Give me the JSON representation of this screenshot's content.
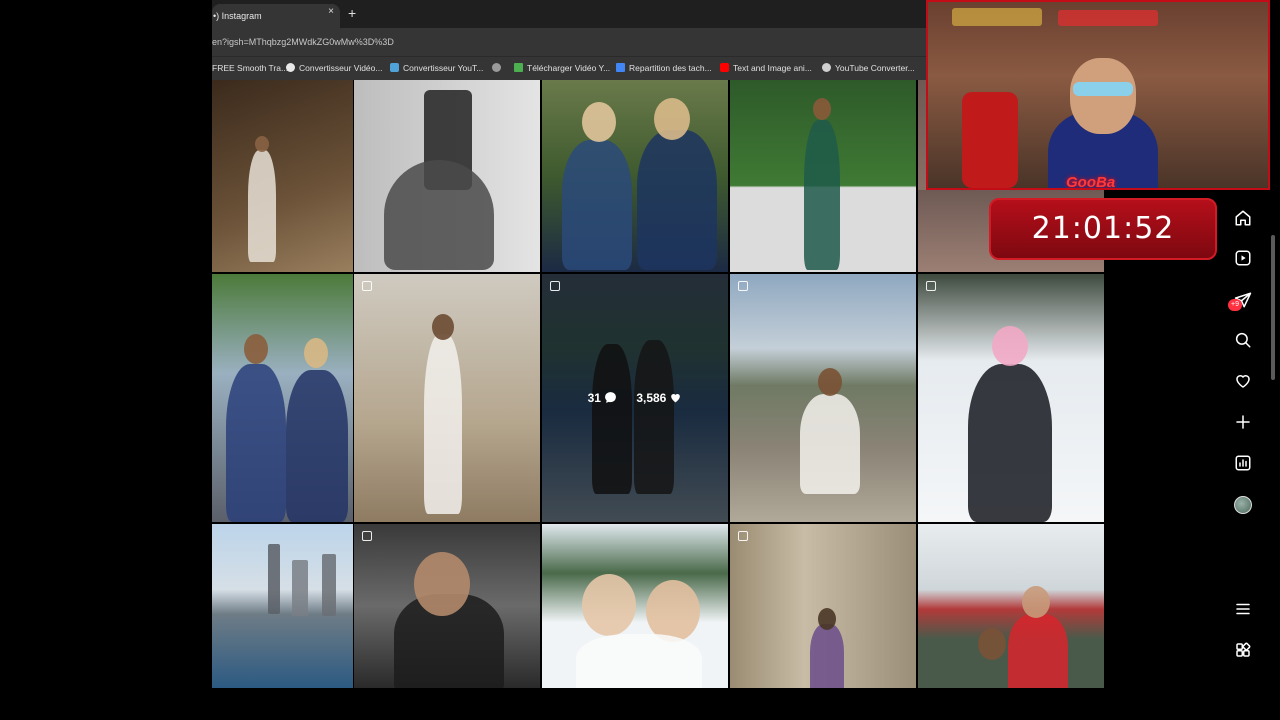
{
  "browser": {
    "tab_title": "•) Instagram",
    "tab_close": "×",
    "new_tab": "+",
    "url": "en?igsh=MThqbzg2MWdkZG0wMw%3D%3D",
    "bookmarks": [
      {
        "label": "FREE Smooth Tra..."
      },
      {
        "label": "Convertisseur Vidéo..."
      },
      {
        "label": "Convertisseur YouT..."
      },
      {
        "label": ""
      },
      {
        "label": "Télécharger Vidéo Y..."
      },
      {
        "label": "Repartition des tach..."
      },
      {
        "label": "Text and Image ani..."
      },
      {
        "label": "YouTube Converter..."
      }
    ]
  },
  "grid": {
    "hovered_post": {
      "comments": "31",
      "likes": "3,586"
    }
  },
  "sidebar": {
    "notification_badge": "+9",
    "items": [
      "home",
      "reels",
      "messages",
      "search",
      "notifications",
      "create",
      "dashboard",
      "profile",
      "more",
      "apps"
    ]
  },
  "overlay": {
    "streamer_name": "GooBa",
    "clock": "21:01:52"
  }
}
